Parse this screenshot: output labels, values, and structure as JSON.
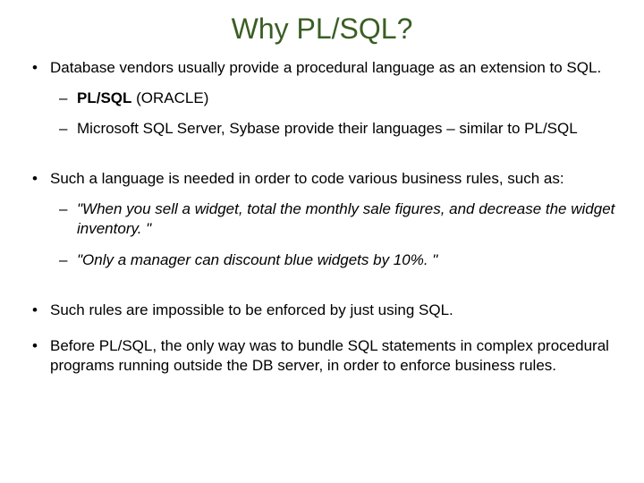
{
  "title": "Why PL/SQL?",
  "bullets": [
    {
      "text": "Database vendors usually provide a procedural language as an extension to SQL.",
      "sub": [
        {
          "strong": "PL/SQL",
          "rest": " (ORACLE)"
        },
        {
          "plain": "Microsoft SQL Server, Sybase provide their languages – similar to PL/SQL"
        }
      ]
    },
    {
      "text": "Such a language is needed in order to code various business rules, such as:",
      "sub": [
        {
          "italic": "\"When you sell a widget, total the monthly sale figures, and decrease the widget inventory. \""
        },
        {
          "italic": "\"Only a manager can discount blue widgets by 10%. \""
        }
      ]
    },
    {
      "text": "Such rules are impossible to be enforced by just using SQL."
    },
    {
      "text": "Before PL/SQL, the only way was to bundle SQL statements in complex procedural programs running outside the DB server, in order to enforce business rules."
    }
  ]
}
